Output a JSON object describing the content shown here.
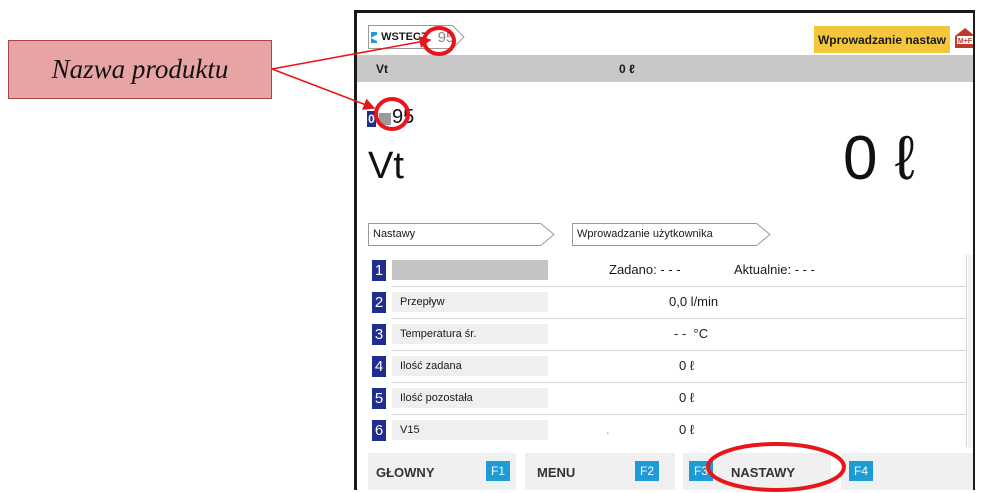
{
  "annotation": {
    "callout_text": "Nazwa produktu"
  },
  "header": {
    "back_label": "WSTECZ",
    "product_number": "95",
    "mode_label": "Wprowadzanie nastaw",
    "logo_text": "M+F"
  },
  "strip": {
    "label": "Vt",
    "value": "0 ℓ"
  },
  "product": {
    "badge": "0",
    "name": "95",
    "measure_label": "Vt",
    "measure_value": "0 ℓ"
  },
  "breadcrumb": {
    "item1": "Nastawy",
    "item2": "Wprowadzanie użytkownika"
  },
  "rows": [
    {
      "num": "1",
      "name": "",
      "value": "",
      "zadano": "Zadano: - - -",
      "aktualnie": "Aktualnie: - - -"
    },
    {
      "num": "2",
      "name": "Przepływ",
      "value": "0,0 l/min"
    },
    {
      "num": "3",
      "name": "Temperatura śr.",
      "value": "- -  °C"
    },
    {
      "num": "4",
      "name": "Ilość zadana",
      "value": "0 ℓ"
    },
    {
      "num": "5",
      "name": "Ilość pozostała",
      "value": "0 ℓ"
    },
    {
      "num": "6",
      "name": "V15",
      "value": "0 ℓ",
      "dot": "."
    }
  ],
  "fkeys": [
    {
      "label": "GŁOWNY",
      "key": "F1"
    },
    {
      "label": "MENU",
      "key": "F2"
    },
    {
      "label": "NASTAWY",
      "key": "F3"
    },
    {
      "label": "",
      "key": "F4"
    }
  ],
  "colors": {
    "accent_blue": "#1d9bd7",
    "badge_navy": "#1f2d8f",
    "mode_yellow": "#f4c63c",
    "annotation_red": "#e8151b",
    "callout_pink": "#e8a4a4"
  }
}
